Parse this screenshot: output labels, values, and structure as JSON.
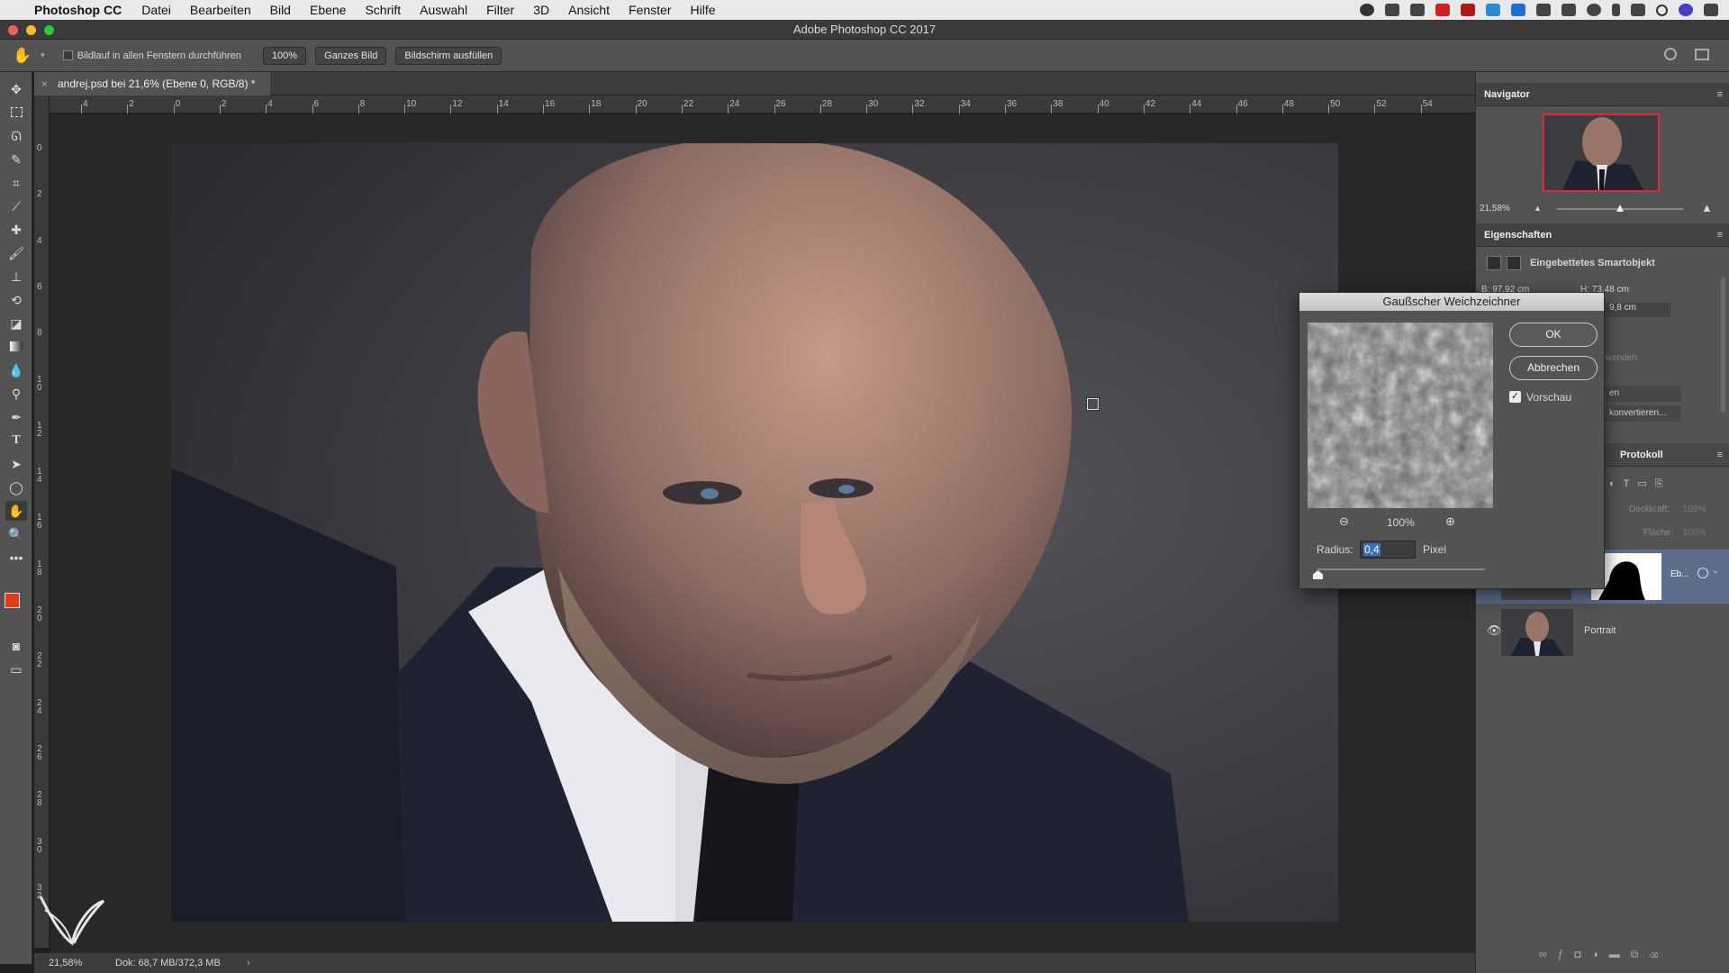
{
  "menubar": {
    "app_name": "Photoshop CC",
    "items": [
      "Datei",
      "Bearbeiten",
      "Bild",
      "Ebene",
      "Schrift",
      "Auswahl",
      "Filter",
      "3D",
      "Ansicht",
      "Fenster",
      "Hilfe"
    ]
  },
  "window": {
    "title": "Adobe Photoshop CC 2017"
  },
  "options_bar": {
    "scroll_all_label": "Bildlauf in allen Fenstern durchführen",
    "zoom_100": "100%",
    "fit_label": "Ganzes Bild",
    "fill_label": "Bildschirm ausfüllen"
  },
  "document": {
    "tab_label": "andrej.psd bei 21,6% (Ebene 0, RGB/8) *"
  },
  "rulers": {
    "h_ticks": [
      "4",
      "2",
      "0",
      "2",
      "4",
      "6",
      "8",
      "10",
      "12",
      "14",
      "16",
      "18",
      "20",
      "22",
      "24",
      "26",
      "28",
      "30",
      "32",
      "34",
      "36",
      "38",
      "40",
      "42",
      "44",
      "46",
      "48",
      "50",
      "52",
      "54"
    ],
    "v_ticks": [
      "0",
      "2",
      "4",
      "6",
      "8",
      "10",
      "12",
      "14",
      "16",
      "18",
      "20",
      "22",
      "24",
      "26",
      "28",
      "30",
      "32"
    ]
  },
  "status": {
    "zoom": "21,58%",
    "doc": "Dok: 68,7 MB/372,3 MB"
  },
  "navigator": {
    "title": "Navigator",
    "zoom": "21,58%",
    "zoom_level": 0.5
  },
  "properties": {
    "title": "Eigenschaften",
    "type_label": "Eingebettetes Smartobjekt",
    "w": "B: 97,92 cm",
    "h": "H: 73,48 cm",
    "y_value": "9,8 cm",
    "apply_partial": "wenden",
    "btn_partial": "en",
    "convert_label": "konvertieren..."
  },
  "layers": {
    "tab_protokoll": "Protokoll",
    "opacity_label": "Deckkraft:",
    "opacity_value": "100%",
    "fill_label": "Fläche:",
    "fill_value": "100%",
    "layer1_name": "Eb...",
    "layer2_name": "Portrait"
  },
  "dialog": {
    "title": "Gaußscher Weichzeichner",
    "ok": "OK",
    "cancel": "Abbrechen",
    "preview_label": "Vorschau",
    "preview_checked": true,
    "zoom": "100%",
    "radius_label": "Radius:",
    "radius_value": "0,4",
    "unit": "Pixel",
    "radius_slider_position": 0.0
  }
}
